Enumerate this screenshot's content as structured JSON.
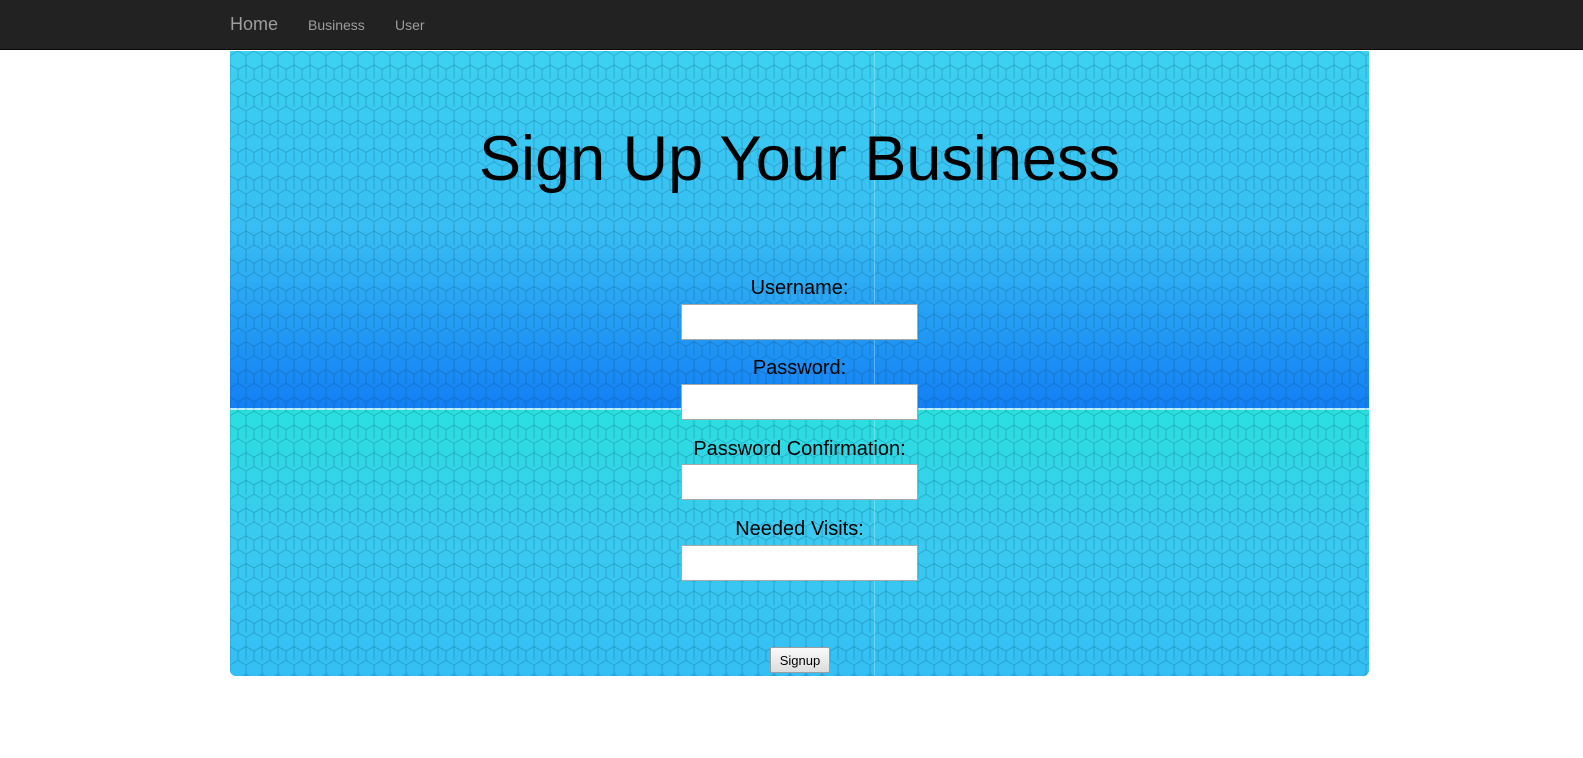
{
  "navbar": {
    "brand": "Home",
    "links": [
      {
        "label": "Business"
      },
      {
        "label": "User"
      }
    ]
  },
  "main": {
    "heading": "Sign Up Your Business",
    "form": {
      "fields": [
        {
          "label": "Username:",
          "value": "",
          "placeholder": ""
        },
        {
          "label": "Password:",
          "value": "",
          "placeholder": ""
        },
        {
          "label": "Password Confirmation:",
          "value": "",
          "placeholder": ""
        },
        {
          "label": "Needed Visits:",
          "value": "",
          "placeholder": ""
        }
      ],
      "submit_label": "Signup"
    }
  },
  "colors": {
    "navbar_bg": "#222222",
    "nav_text": "#9d9d9d",
    "background_top": "#35bdf2",
    "background_bottom": "#38c6f0",
    "background_deep_blue": "#0f78f5"
  }
}
